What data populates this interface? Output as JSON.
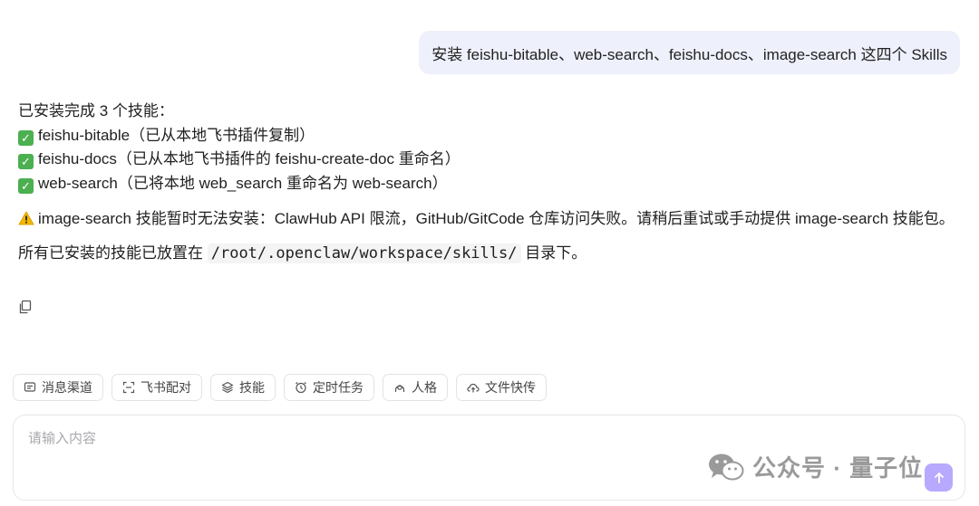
{
  "user_message": "安装 feishu-bitable、web-search、feishu-docs、image-search 这四个 Skills",
  "assistant": {
    "intro": "已安装完成 3 个技能：",
    "installed": [
      "feishu-bitable（已从本地飞书插件复制）",
      "feishu-docs（已从本地飞书插件的 feishu-create-doc 重命名）",
      "web-search（已将本地 web_search 重命名为 web-search）"
    ],
    "warning": "image-search 技能暂时无法安装：ClawHub API 限流，GitHub/GitCode 仓库访问失败。请稍后重试或手动提供 image-search 技能包。",
    "dir_prefix": "所有已安装的技能已放置在",
    "dir_path": "/root/.openclaw/workspace/skills/",
    "dir_suffix": "目录下。"
  },
  "toolbar": [
    {
      "label": "消息渠道",
      "icon": "message-icon"
    },
    {
      "label": "飞书配对",
      "icon": "scan-icon"
    },
    {
      "label": "技能",
      "icon": "layers-icon"
    },
    {
      "label": "定时任务",
      "icon": "alarm-icon"
    },
    {
      "label": "人格",
      "icon": "persona-icon"
    },
    {
      "label": "文件快传",
      "icon": "cloud-upload-icon"
    }
  ],
  "input": {
    "placeholder": "请输入内容"
  },
  "watermark": "公众号 · 量子位",
  "colors": {
    "bubble": "#eef0fb",
    "send": "#b8a9ff",
    "check": "#4caf50",
    "warning": "#f5b800"
  }
}
